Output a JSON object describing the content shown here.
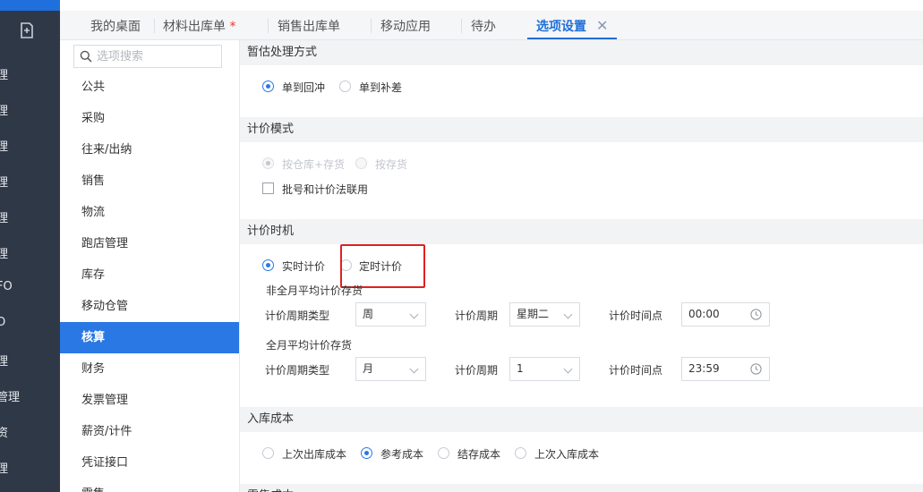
{
  "nav": {
    "items": [
      "理",
      "理",
      "理",
      "理",
      "理",
      "理",
      "FO",
      "O",
      "理",
      "管理",
      "资",
      "理"
    ]
  },
  "tabs": [
    {
      "label": "我的桌面"
    },
    {
      "label": "材料出库单",
      "modified": "*"
    },
    {
      "label": "销售出库单"
    },
    {
      "label": "移动应用"
    },
    {
      "label": "待办"
    },
    {
      "label": "选项设置",
      "close": "✕"
    }
  ],
  "options": {
    "search_placeholder": "选项搜索",
    "items": [
      "公共",
      "采购",
      "往来/出纳",
      "销售",
      "物流",
      "跑店管理",
      "库存",
      "移动仓管",
      "核算",
      "财务",
      "发票管理",
      "薪资/计件",
      "凭证接口",
      "零售"
    ],
    "active_index": 8
  },
  "sections": {
    "estimate": {
      "title": "暂估处理方式",
      "radio1": "单到回冲",
      "radio2": "单到补差"
    },
    "pricing_mode": {
      "title": "计价模式",
      "radio1": "按仓库+存货",
      "radio2": "按存货",
      "checkbox": "批号和计价法联用"
    },
    "pricing_timing": {
      "title": "计价时机",
      "radio1": "实时计价",
      "radio2": "定时计价",
      "sub1": {
        "title": "非全月平均计价存货",
        "period_type_label": "计价周期类型",
        "period_type_value": "周",
        "period_label": "计价周期",
        "period_value": "星期二",
        "time_label": "计价时间点",
        "time_value": "00:00"
      },
      "sub2": {
        "title": "全月平均计价存货",
        "period_type_label": "计价周期类型",
        "period_type_value": "月",
        "period_label": "计价周期",
        "period_value": "1",
        "time_label": "计价时间点",
        "time_value": "23:59"
      }
    },
    "inbound_cost": {
      "title": "入库成本",
      "radio1": "上次出库成本",
      "radio2": "参考成本",
      "radio3": "结存成本",
      "radio4": "上次入库成本"
    },
    "next_title": "零售成本"
  },
  "colors": {
    "accent": "#2a78e4",
    "nav_bg": "#2f3847",
    "highlight": "#e02020"
  }
}
